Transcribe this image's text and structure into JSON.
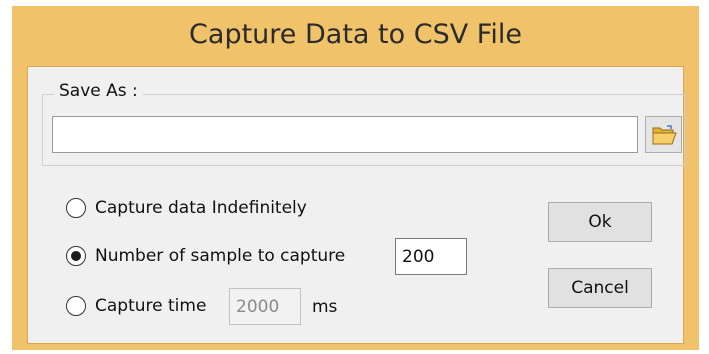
{
  "dialog": {
    "title": "Capture Data to CSV File"
  },
  "save_as": {
    "group_label": "Save As :",
    "path_value": "",
    "browse_icon": "open-folder-icon"
  },
  "options": {
    "indefinite_label": "Capture data Indefinitely",
    "samples_label": "Number of sample to capture",
    "samples_value": "200",
    "time_label": "Capture time",
    "time_value": "2000",
    "time_unit": "ms",
    "selected": "samples"
  },
  "buttons": {
    "ok_label": "Ok",
    "cancel_label": "Cancel"
  },
  "colors": {
    "title_bar": "#f0c26a",
    "client_bg": "#f0f0f0"
  }
}
